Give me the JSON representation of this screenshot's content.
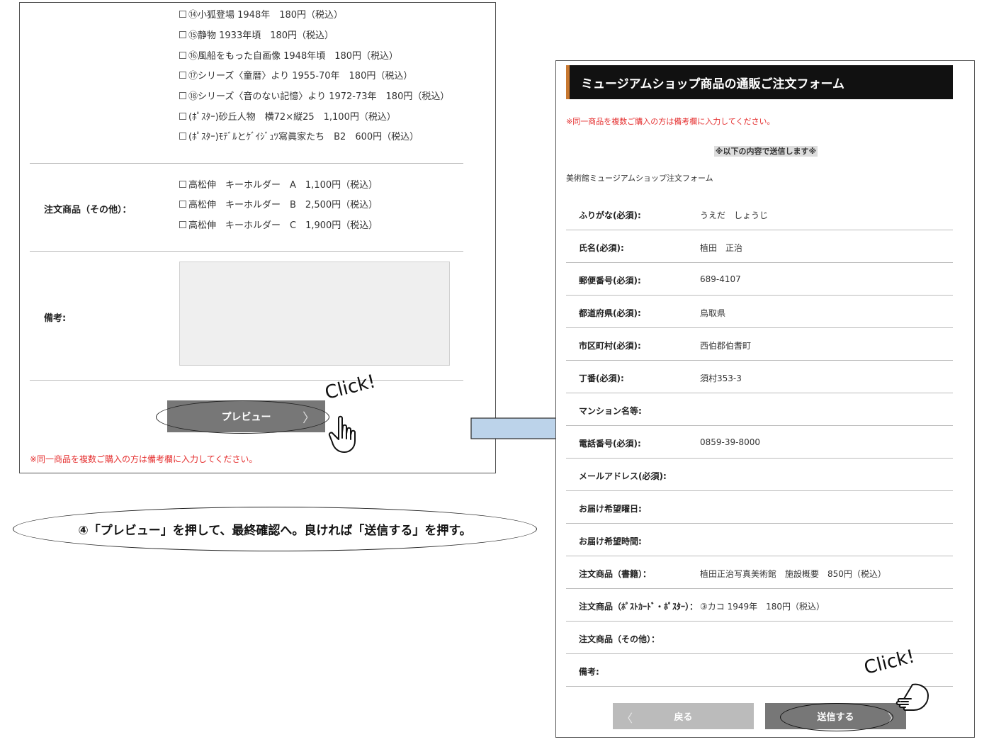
{
  "left_form": {
    "book_items": [
      {
        "label": "⑭小狐登場 1948年　180円（税込）"
      },
      {
        "label": "⑮静物 1933年頃　180円（税込）"
      },
      {
        "label": "⑯風船をもった自画像 1948年頃　180円（税込）"
      },
      {
        "label": "⑰シリーズ〈童暦〉より 1955-70年　180円（税込）"
      },
      {
        "label": "⑱シリーズ〈音のない記憶〉より 1972-73年　180円（税込）"
      },
      {
        "label": "(ﾎﾟｽﾀｰ)砂丘人物　横72×縦25　1,100円（税込）"
      },
      {
        "label": "(ﾎﾟｽﾀｰ)ﾓﾃﾞﾙとｹﾞｲｼﾞｭﾂ寫眞家たち　B2　600円（税込）"
      }
    ],
    "other_label": "注文商品（その他）：",
    "other_items": [
      {
        "label": "高松伸　キーホルダー　A　1,100円（税込）"
      },
      {
        "label": "高松伸　キーホルダー　B　2,500円（税込）"
      },
      {
        "label": "高松伸　キーホルダー　C　1,900円（税込）"
      }
    ],
    "remarks_label": "備考:",
    "remarks_value": "",
    "preview_button": "プレビュー",
    "preview_chevron": "〉",
    "note": "※同一商品を複数ご購入の方は備考欄に入力してください。"
  },
  "click_label": "Click!",
  "caption": "④「プレビュー」を押して、最終確認へ。良ければ「送信する」を押す。",
  "right_form": {
    "title": "ミュージアムショップ商品の通販ご注文フォーム",
    "note": "※同一商品を複数ご購入の方は備考欄に入力してください。",
    "confirm_heading": "※以下の内容で送信します※",
    "form_name": "美術館ミュージアムショップ注文フォーム",
    "rows": [
      {
        "label": "ふりがな(必須):",
        "value": "うえだ　しょうじ"
      },
      {
        "label": "氏名(必須):",
        "value": "植田　正治"
      },
      {
        "label": "郵便番号(必須):",
        "value": "689-4107"
      },
      {
        "label": "都道府県(必須):",
        "value": "鳥取県"
      },
      {
        "label": "市区町村(必須):",
        "value": "西伯郡伯耆町"
      },
      {
        "label": "丁番(必須):",
        "value": "須村353-3"
      },
      {
        "label": "マンション名等:",
        "value": ""
      },
      {
        "label": "電話番号(必須):",
        "value": "0859-39-8000"
      },
      {
        "label": "メールアドレス(必須):",
        "value": ""
      },
      {
        "label": "お届け希望曜日:",
        "value": ""
      },
      {
        "label": "お届け希望時間:",
        "value": ""
      },
      {
        "label": "注文商品（書籍）：",
        "value": "植田正治写真美術館　施設概要　850円（税込）"
      },
      {
        "label": "注文商品（ﾎﾟｽﾄｶｰﾄﾞ・ﾎﾟｽﾀｰ）：",
        "value": "③カコ 1949年　180円（税込）"
      },
      {
        "label": "注文商品（その他）：",
        "value": ""
      },
      {
        "label": "備考:",
        "value": ""
      }
    ],
    "back_button": "戻る",
    "back_chevron": "〈",
    "submit_button": "送信する",
    "submit_chevron": "〉"
  },
  "colors": {
    "accent_note": "#e53030",
    "title_bar": "#111111",
    "title_accent": "#c87830",
    "button": "#777777",
    "button_disabled": "#bbbbbb",
    "arrow_fill": "#bcd3ea"
  }
}
